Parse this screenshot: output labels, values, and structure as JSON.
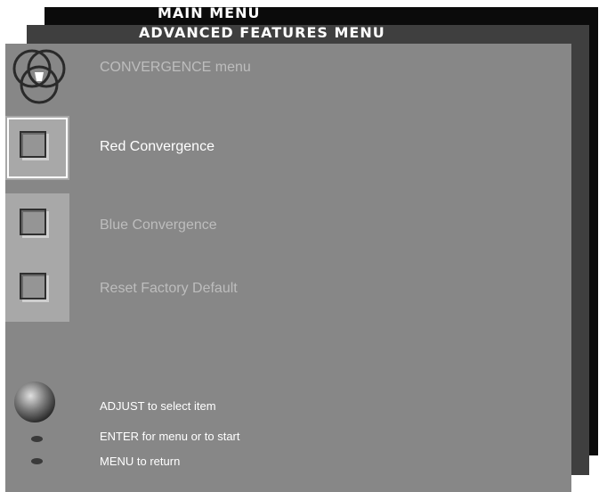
{
  "main_menu": {
    "title": "MAIN MENU"
  },
  "advanced_menu": {
    "title": "ADVANCED FEATURES MENU"
  },
  "convergence": {
    "title": "CONVERGENCE menu",
    "header_icon": "rgb-circles-icon",
    "items": [
      {
        "label": "Red Convergence",
        "state": "selected",
        "icon": "square-button-icon"
      },
      {
        "label": "Blue Convergence",
        "state": "inactive",
        "icon": "square-button-icon"
      },
      {
        "label": "Reset Factory Default",
        "state": "inactive",
        "icon": "square-button-icon"
      }
    ]
  },
  "help": {
    "adjust": "ADJUST to select item",
    "enter": "ENTER for menu or to start",
    "menu": "MENU to return",
    "icons": [
      "adjust-knob-icon",
      "enter-button-icon",
      "menu-button-icon"
    ]
  },
  "colors": {
    "main_bg": "#0b0b0b",
    "advanced_bg": "#3f3f3f",
    "panel_bg": "#878787",
    "item_tile": "#a8a8a8",
    "active_text": "#ffffff",
    "inactive_text": "#bdbdbd"
  }
}
